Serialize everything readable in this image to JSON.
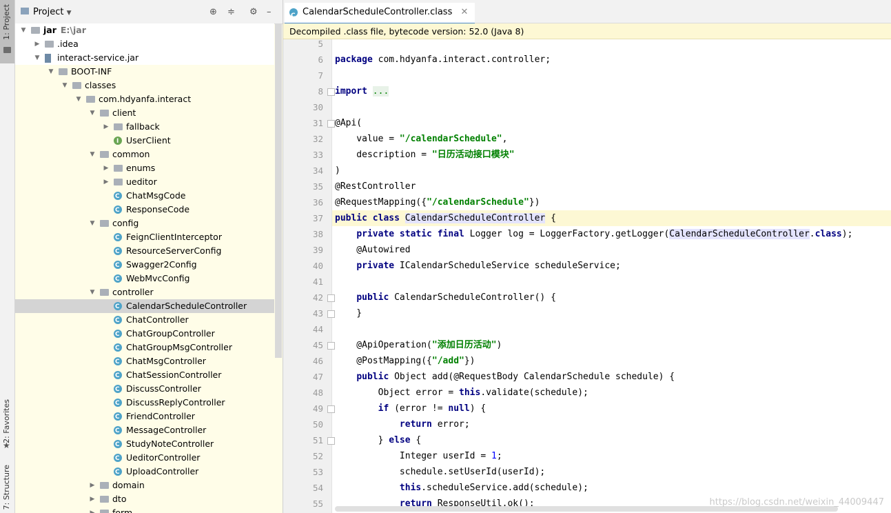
{
  "sidebar": {
    "project_tab": "1: Project",
    "favorites_tab": "2: Favorites",
    "structure_tab": "7: Structure"
  },
  "project_panel": {
    "title": "Project",
    "tree": [
      {
        "label": "jar",
        "extra": "E:\\jar",
        "indent": 0,
        "arrow": "down",
        "icon": "folder",
        "bold": true
      },
      {
        "label": ".idea",
        "indent": 1,
        "arrow": "right",
        "icon": "folder"
      },
      {
        "label": "interact-service.jar",
        "indent": 1,
        "arrow": "down",
        "icon": "jar"
      },
      {
        "label": "BOOT-INF",
        "indent": 2,
        "arrow": "down",
        "icon": "folder"
      },
      {
        "label": "classes",
        "indent": 3,
        "arrow": "down",
        "icon": "folder"
      },
      {
        "label": "com.hdyanfa.interact",
        "indent": 4,
        "arrow": "down",
        "icon": "folder"
      },
      {
        "label": "client",
        "indent": 5,
        "arrow": "down",
        "icon": "folder"
      },
      {
        "label": "fallback",
        "indent": 6,
        "arrow": "right",
        "icon": "folder"
      },
      {
        "label": "UserClient",
        "indent": 6,
        "arrow": "",
        "icon": "interface"
      },
      {
        "label": "common",
        "indent": 5,
        "arrow": "down",
        "icon": "folder"
      },
      {
        "label": "enums",
        "indent": 6,
        "arrow": "right",
        "icon": "folder"
      },
      {
        "label": "ueditor",
        "indent": 6,
        "arrow": "right",
        "icon": "folder"
      },
      {
        "label": "ChatMsgCode",
        "indent": 6,
        "arrow": "",
        "icon": "class"
      },
      {
        "label": "ResponseCode",
        "indent": 6,
        "arrow": "",
        "icon": "class"
      },
      {
        "label": "config",
        "indent": 5,
        "arrow": "down",
        "icon": "folder"
      },
      {
        "label": "FeignClientInterceptor",
        "indent": 6,
        "arrow": "",
        "icon": "class"
      },
      {
        "label": "ResourceServerConfig",
        "indent": 6,
        "arrow": "",
        "icon": "class"
      },
      {
        "label": "Swagger2Config",
        "indent": 6,
        "arrow": "",
        "icon": "class"
      },
      {
        "label": "WebMvcConfig",
        "indent": 6,
        "arrow": "",
        "icon": "class"
      },
      {
        "label": "controller",
        "indent": 5,
        "arrow": "down",
        "icon": "folder"
      },
      {
        "label": "CalendarScheduleController",
        "indent": 6,
        "arrow": "",
        "icon": "class",
        "selected": true
      },
      {
        "label": "ChatController",
        "indent": 6,
        "arrow": "",
        "icon": "class"
      },
      {
        "label": "ChatGroupController",
        "indent": 6,
        "arrow": "",
        "icon": "class"
      },
      {
        "label": "ChatGroupMsgController",
        "indent": 6,
        "arrow": "",
        "icon": "class"
      },
      {
        "label": "ChatMsgController",
        "indent": 6,
        "arrow": "",
        "icon": "class"
      },
      {
        "label": "ChatSessionController",
        "indent": 6,
        "arrow": "",
        "icon": "class"
      },
      {
        "label": "DiscussController",
        "indent": 6,
        "arrow": "",
        "icon": "class"
      },
      {
        "label": "DiscussReplyController",
        "indent": 6,
        "arrow": "",
        "icon": "class"
      },
      {
        "label": "FriendController",
        "indent": 6,
        "arrow": "",
        "icon": "class"
      },
      {
        "label": "MessageController",
        "indent": 6,
        "arrow": "",
        "icon": "class"
      },
      {
        "label": "StudyNoteController",
        "indent": 6,
        "arrow": "",
        "icon": "class"
      },
      {
        "label": "UeditorController",
        "indent": 6,
        "arrow": "",
        "icon": "class"
      },
      {
        "label": "UploadController",
        "indent": 6,
        "arrow": "",
        "icon": "class"
      },
      {
        "label": "domain",
        "indent": 5,
        "arrow": "right",
        "icon": "folder"
      },
      {
        "label": "dto",
        "indent": 5,
        "arrow": "right",
        "icon": "folder"
      },
      {
        "label": "form",
        "indent": 5,
        "arrow": "right",
        "icon": "folder"
      }
    ]
  },
  "editor": {
    "tab_label": "CalendarScheduleController.class",
    "banner": "Decompiled .class file, bytecode version: 52.0 (Java 8)",
    "current_line": "37",
    "lines": [
      {
        "n": "5",
        "html": ""
      },
      {
        "n": "6",
        "html": "<span class='kw'>package</span> com.hdyanfa.interact.controller;"
      },
      {
        "n": "7",
        "html": ""
      },
      {
        "n": "8",
        "html": "<span class='kw'>import</span> <span style='background:#e8f2e8;color:#008000'>...</span>",
        "fold": true
      },
      {
        "n": "30",
        "html": ""
      },
      {
        "n": "31",
        "html": "@Api(",
        "fold": true
      },
      {
        "n": "32",
        "html": "    value = <span class='str'>\"/calendarSchedule\"</span>,"
      },
      {
        "n": "33",
        "html": "    description = <span class='str'>\"日历活动接口模块\"</span>"
      },
      {
        "n": "34",
        "html": ")"
      },
      {
        "n": "35",
        "html": "@RestController"
      },
      {
        "n": "36",
        "html": "@RequestMapping({<span class='str'>\"/calendarSchedule\"</span>})"
      },
      {
        "n": "37",
        "html": "<span class='kw'>public class</span> <span class='hl'>CalendarScheduleController</span> {"
      },
      {
        "n": "38",
        "html": "    <span class='kw'>private static final</span> Logger log = LoggerFactory.getLogger(<span class='hl'>CalendarScheduleController</span>.<span class='kw'>class</span>);"
      },
      {
        "n": "39",
        "html": "    @Autowired"
      },
      {
        "n": "40",
        "html": "    <span class='kw'>private</span> ICalendarScheduleService scheduleService;"
      },
      {
        "n": "41",
        "html": ""
      },
      {
        "n": "42",
        "html": "    <span class='kw'>public</span> CalendarScheduleController() {",
        "fold": true
      },
      {
        "n": "43",
        "html": "    }",
        "fold": true
      },
      {
        "n": "44",
        "html": ""
      },
      {
        "n": "45",
        "html": "    @ApiOperation(<span class='str'>\"添加日历活动\"</span>)",
        "fold": true
      },
      {
        "n": "46",
        "html": "    @PostMapping({<span class='str'>\"/add\"</span>})"
      },
      {
        "n": "47",
        "html": "    <span class='kw'>public</span> Object add(@RequestBody CalendarSchedule schedule) {"
      },
      {
        "n": "48",
        "html": "        Object error = <span class='kw'>this</span>.validate(schedule);"
      },
      {
        "n": "49",
        "html": "        <span class='kw'>if</span> (error != <span class='kw'>null</span>) {",
        "fold": true
      },
      {
        "n": "50",
        "html": "            <span class='kw'>return</span> error;"
      },
      {
        "n": "51",
        "html": "        } <span class='kw'>else</span> {",
        "fold": true
      },
      {
        "n": "52",
        "html": "            Integer userId = <span class='num'>1</span>;"
      },
      {
        "n": "53",
        "html": "            schedule.setUserId(userId);"
      },
      {
        "n": "54",
        "html": "            <span class='kw'>this</span>.scheduleService.add(schedule);"
      },
      {
        "n": "55",
        "html": "            <span class='kw'>return</span> ResponseUtil.ok();"
      }
    ]
  },
  "watermark": "https://blog.csdn.net/weixin_44009447",
  "colors": {
    "keyword": "#000080",
    "string": "#008000",
    "number": "#0000ff",
    "panel_bg": "#fffde8",
    "selection": "#d4d4d4",
    "tab_accent": "#4a88c7"
  }
}
